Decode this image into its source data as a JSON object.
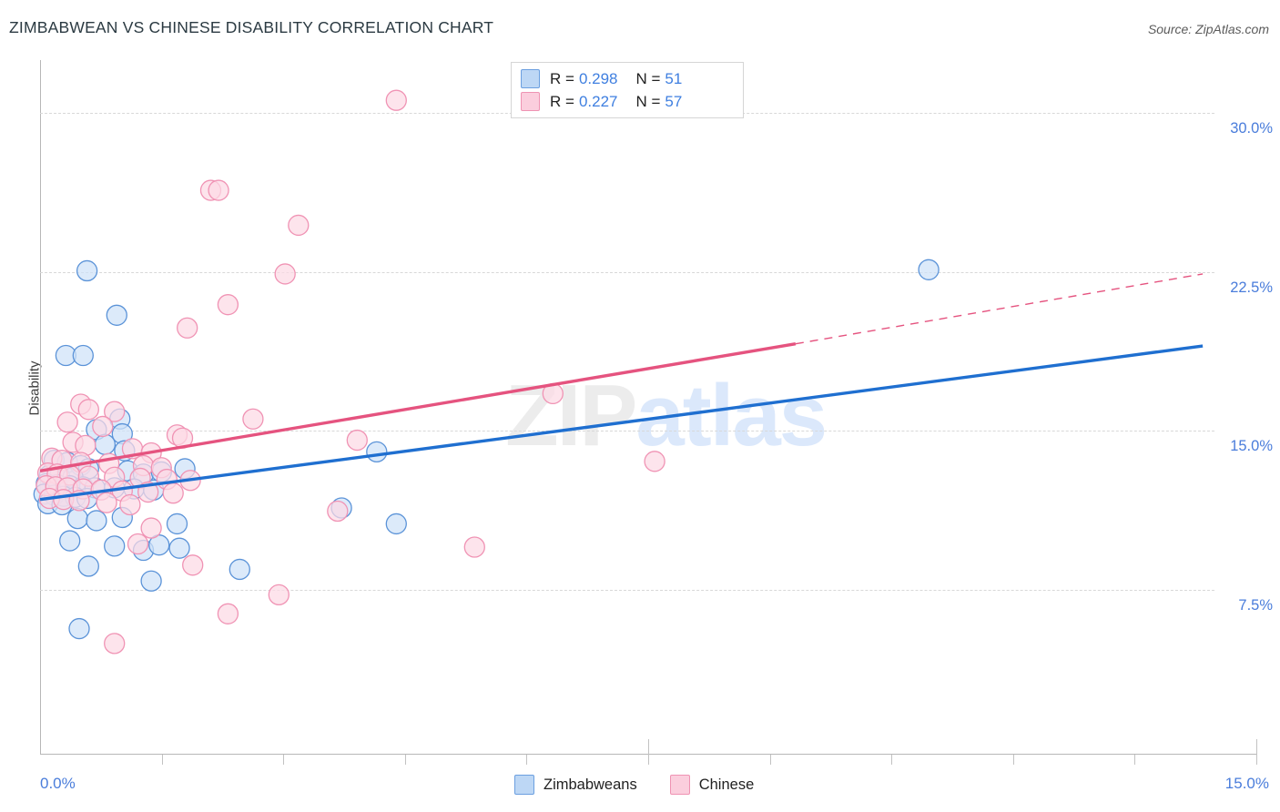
{
  "header": {
    "title": "ZIMBABWEAN VS CHINESE DISABILITY CORRELATION CHART",
    "source": "Source: ZipAtlas.com"
  },
  "watermark": {
    "part1": "ZIP",
    "part2": "atlas"
  },
  "stats": {
    "rows": [
      {
        "series": "Zimbabweans",
        "r_label": "R = ",
        "r_value": "0.298",
        "n_label": "N = ",
        "n_value": "51",
        "color": "#bdd7f5"
      },
      {
        "series": "Chinese",
        "r_label": "R = ",
        "r_value": "0.227",
        "n_label": "N = ",
        "n_value": "57",
        "color": "#fbcedd"
      }
    ]
  },
  "footer_legend": [
    {
      "label": "Zimbabweans",
      "color": "#bdd7f5",
      "border": "#6b9fe0"
    },
    {
      "label": "Chinese",
      "color": "#fbcedd",
      "border": "#ef93b3"
    }
  ],
  "colors": {
    "blue_fill": "#cfe2f8",
    "blue_stroke": "#5b93d8",
    "pink_fill": "#fcd9e5",
    "pink_stroke": "#f093b4",
    "blue_line": "#1f6fd0",
    "pink_line": "#e5537f",
    "axis": "#b7b7b7",
    "grid": "#d8d8d8",
    "tick_text": "#4a7ddb"
  },
  "chart_data": {
    "type": "scatter",
    "title": "ZIMBABWEAN VS CHINESE DISABILITY CORRELATION CHART",
    "xlabel": "",
    "ylabel": "Disability",
    "xlim": [
      0.0,
      15.0
    ],
    "ylim": [
      0.0,
      32.5
    ],
    "x_tick_labels": [
      "0.0%",
      "15.0%"
    ],
    "y_tick_labels": [
      "7.5%",
      "15.0%",
      "22.5%",
      "30.0%"
    ],
    "y_ticks": [
      7.5,
      15.0,
      22.5,
      30.0
    ],
    "grid": true,
    "legend_position": "bottom-center",
    "series": [
      {
        "name": "Zimbabweans",
        "color": "#cfe2f8",
        "stroke": "#5b93d8",
        "R": 0.298,
        "N": 51,
        "trendline": {
          "style": "solid",
          "color": "#1f6fd0",
          "x0": 0.0,
          "y0": 11.75,
          "x1": 14.85,
          "y1": 19.0
        },
        "points": [
          [
            0.6,
            22.55
          ],
          [
            0.98,
            20.45
          ],
          [
            0.33,
            18.55
          ],
          [
            0.55,
            18.55
          ],
          [
            1.02,
            15.55
          ],
          [
            0.72,
            15.05
          ],
          [
            1.05,
            14.85
          ],
          [
            0.83,
            14.35
          ],
          [
            1.08,
            14.05
          ],
          [
            0.18,
            13.6
          ],
          [
            0.35,
            13.5
          ],
          [
            0.52,
            13.35
          ],
          [
            0.62,
            13.2
          ],
          [
            0.12,
            12.9
          ],
          [
            0.25,
            12.85
          ],
          [
            0.42,
            12.8
          ],
          [
            1.12,
            13.1
          ],
          [
            1.32,
            12.95
          ],
          [
            1.55,
            13.05
          ],
          [
            1.85,
            13.2
          ],
          [
            0.08,
            12.5
          ],
          [
            0.22,
            12.45
          ],
          [
            0.38,
            12.4
          ],
          [
            0.55,
            12.35
          ],
          [
            0.7,
            12.3
          ],
          [
            0.95,
            12.3
          ],
          [
            1.2,
            12.25
          ],
          [
            1.45,
            12.2
          ],
          [
            0.05,
            12.0
          ],
          [
            0.18,
            11.95
          ],
          [
            0.3,
            11.9
          ],
          [
            0.45,
            11.85
          ],
          [
            0.6,
            11.8
          ],
          [
            0.1,
            11.55
          ],
          [
            0.28,
            11.5
          ],
          [
            4.3,
            14.0
          ],
          [
            3.85,
            11.35
          ],
          [
            0.48,
            10.85
          ],
          [
            0.72,
            10.75
          ],
          [
            1.05,
            10.9
          ],
          [
            1.75,
            10.6
          ],
          [
            4.55,
            10.6
          ],
          [
            0.38,
            9.8
          ],
          [
            0.95,
            9.55
          ],
          [
            1.32,
            9.35
          ],
          [
            1.52,
            9.6
          ],
          [
            1.78,
            9.45
          ],
          [
            0.62,
            8.6
          ],
          [
            2.55,
            8.45
          ],
          [
            1.42,
            7.9
          ],
          [
            0.5,
            5.65
          ],
          [
            11.35,
            22.6
          ]
        ]
      },
      {
        "name": "Chinese",
        "color": "#fcd9e5",
        "stroke": "#f093b4",
        "R": 0.227,
        "N": 57,
        "trendline": {
          "style": "solid-then-dashed",
          "color": "#e5537f",
          "x0": 0.0,
          "y0": 13.1,
          "x1": 9.65,
          "y1": 19.1,
          "x2": 14.85,
          "y2": 22.4,
          "dash_from_x": 9.65
        },
        "points": [
          [
            4.55,
            30.6
          ],
          [
            2.18,
            26.35
          ],
          [
            2.28,
            26.35
          ],
          [
            3.3,
            24.7
          ],
          [
            3.13,
            22.4
          ],
          [
            2.4,
            20.95
          ],
          [
            1.88,
            19.85
          ],
          [
            0.52,
            16.25
          ],
          [
            0.62,
            16.0
          ],
          [
            0.95,
            15.9
          ],
          [
            0.35,
            15.4
          ],
          [
            0.8,
            15.2
          ],
          [
            2.72,
            15.55
          ],
          [
            6.55,
            16.75
          ],
          [
            1.75,
            14.8
          ],
          [
            1.82,
            14.65
          ],
          [
            0.42,
            14.45
          ],
          [
            0.58,
            14.3
          ],
          [
            1.18,
            14.15
          ],
          [
            1.42,
            13.95
          ],
          [
            0.15,
            13.7
          ],
          [
            0.28,
            13.6
          ],
          [
            0.52,
            13.5
          ],
          [
            0.88,
            13.45
          ],
          [
            1.32,
            13.35
          ],
          [
            1.55,
            13.25
          ],
          [
            4.05,
            14.55
          ],
          [
            0.1,
            13.0
          ],
          [
            0.22,
            12.95
          ],
          [
            0.38,
            12.9
          ],
          [
            0.62,
            12.85
          ],
          [
            0.95,
            12.8
          ],
          [
            1.28,
            12.75
          ],
          [
            1.62,
            12.7
          ],
          [
            1.92,
            12.65
          ],
          [
            0.08,
            12.4
          ],
          [
            0.2,
            12.35
          ],
          [
            0.35,
            12.3
          ],
          [
            0.55,
            12.25
          ],
          [
            0.78,
            12.2
          ],
          [
            1.05,
            12.15
          ],
          [
            1.38,
            12.1
          ],
          [
            1.7,
            12.05
          ],
          [
            7.85,
            13.55
          ],
          [
            0.12,
            11.8
          ],
          [
            0.3,
            11.75
          ],
          [
            0.5,
            11.7
          ],
          [
            0.85,
            11.6
          ],
          [
            1.15,
            11.5
          ],
          [
            3.8,
            11.2
          ],
          [
            1.42,
            10.4
          ],
          [
            1.25,
            9.65
          ],
          [
            5.55,
            9.5
          ],
          [
            1.95,
            8.65
          ],
          [
            3.05,
            7.25
          ],
          [
            2.4,
            6.35
          ],
          [
            0.95,
            4.95
          ]
        ]
      }
    ]
  }
}
